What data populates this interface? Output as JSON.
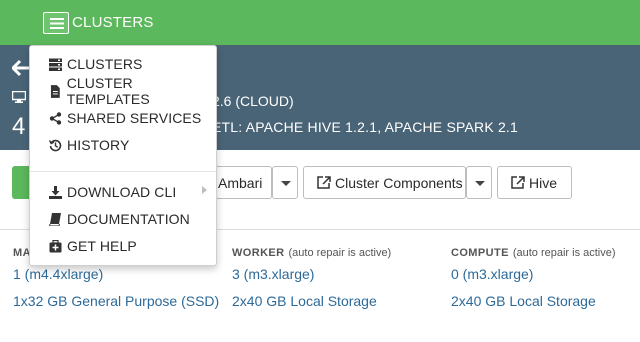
{
  "topbar": {
    "title": "CLUSTERS",
    "menu_icon": "hamburger-icon"
  },
  "header": {
    "number": "4",
    "version_fragment": "2.6 (CLOUD)",
    "stack_fragment": "ETL: APACHE HIVE 1.2.1, APACHE SPARK 2.1"
  },
  "actions": {
    "ambari_label": "Ambari",
    "components_label": "Cluster Components",
    "hive_label": "Hive"
  },
  "groups": {
    "master": {
      "heading": "MA",
      "count": "1 (m4.4xlarge)",
      "storage": "1x32 GB General Purpose (SSD)"
    },
    "worker": {
      "heading": "WORKER",
      "note": "(auto repair is active)",
      "count": "3 (m3.xlarge)",
      "storage": "2x40 GB Local Storage"
    },
    "compute": {
      "heading": "COMPUTE",
      "note": "(auto repair is active)",
      "count": "0 (m3.xlarge)",
      "storage": "2x40 GB Local Storage"
    }
  },
  "dropdown": {
    "items": [
      {
        "label": "CLUSTERS",
        "icon": "server-icon"
      },
      {
        "label": "CLUSTER TEMPLATES",
        "icon": "file-icon"
      },
      {
        "label": "SHARED SERVICES",
        "icon": "share-icon"
      },
      {
        "label": "HISTORY",
        "icon": "history-icon"
      },
      {
        "label": "DOWNLOAD CLI",
        "icon": "download-icon"
      },
      {
        "label": "DOCUMENTATION",
        "icon": "book-icon"
      },
      {
        "label": "GET HELP",
        "icon": "medkit-icon"
      }
    ]
  },
  "colors": {
    "topbar": "#5cb85c",
    "header": "#4a6477",
    "link": "#2d6a99"
  }
}
